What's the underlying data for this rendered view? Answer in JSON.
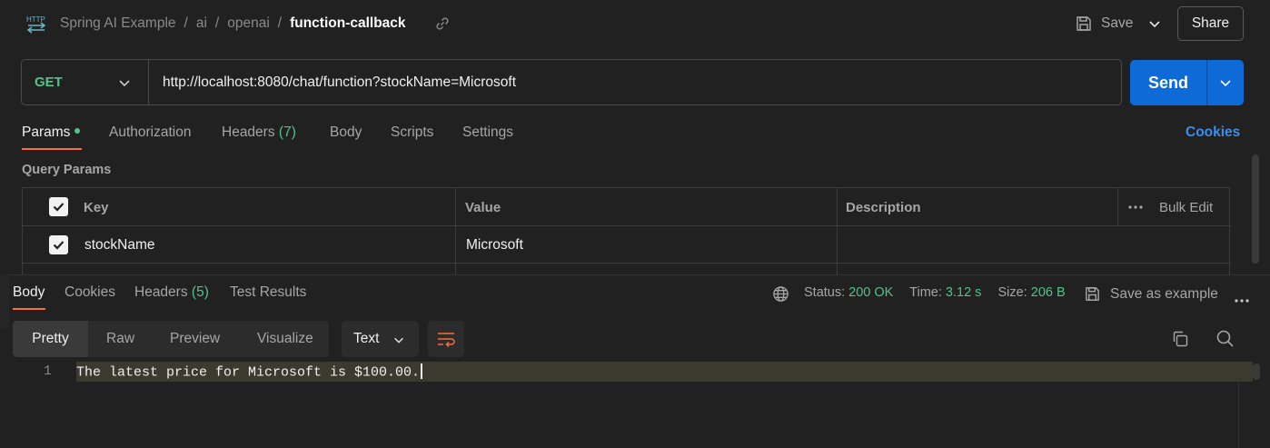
{
  "header": {
    "breadcrumb": [
      "Spring AI Example",
      "ai",
      "openai"
    ],
    "separator": "/",
    "current": "function-callback",
    "save_label": "Save",
    "share_label": "Share"
  },
  "request": {
    "method": "GET",
    "url": "http://localhost:8080/chat/function?stockName=Microsoft",
    "send_label": "Send"
  },
  "request_tabs": {
    "params": "Params",
    "authorization": "Authorization",
    "headers": "Headers",
    "headers_count": "(7)",
    "body": "Body",
    "scripts": "Scripts",
    "settings": "Settings",
    "cookies": "Cookies"
  },
  "query_params": {
    "title": "Query Params",
    "columns": {
      "key": "Key",
      "value": "Value",
      "description": "Description",
      "bulk_edit": "Bulk Edit"
    },
    "rows": [
      {
        "key": "stockName",
        "value": "Microsoft",
        "description": "",
        "checked": true
      }
    ]
  },
  "response": {
    "tabs": {
      "body": "Body",
      "cookies": "Cookies",
      "headers": "Headers",
      "headers_count": "(5)",
      "test_results": "Test Results"
    },
    "status_label": "Status:",
    "status_value": "200 OK",
    "time_label": "Time:",
    "time_value": "3.12 s",
    "size_label": "Size:",
    "size_value": "206 B",
    "save_example_label": "Save as example",
    "formats": {
      "pretty": "Pretty",
      "raw": "Raw",
      "preview": "Preview",
      "visualize": "Visualize"
    },
    "content_type": "Text",
    "lines": [
      {
        "number": "1",
        "text": "The latest price for Microsoft is $100.00."
      }
    ]
  },
  "colors": {
    "accent_orange": "#ff6c37",
    "send_blue": "#0e6ad6",
    "success_green": "#52c28a",
    "link_blue": "#3d8ee8"
  }
}
